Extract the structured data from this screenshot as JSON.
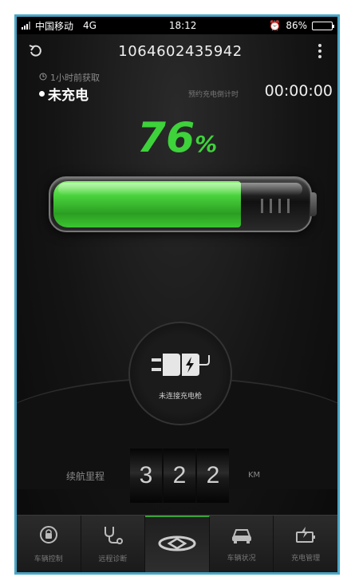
{
  "status_bar": {
    "carrier": "中国移动",
    "network": "4G",
    "time": "18:12",
    "battery": "86%",
    "battery_level": 0.86
  },
  "header": {
    "title": "1064602435942"
  },
  "info": {
    "fetched_text": "1小时前获取",
    "charge_state": "未充电",
    "countdown_label": "预约充电倒计时",
    "countdown_value": "00:00:00"
  },
  "battery": {
    "percent_number": "76",
    "percent_unit": "%",
    "level": 0.76,
    "fill_color": "#3ed23b"
  },
  "plug": {
    "label": "未连接充电枪"
  },
  "range": {
    "label": "续航里程",
    "digits": [
      "3",
      "2",
      "2"
    ],
    "unit": "KM"
  },
  "tabs": [
    {
      "label": "车辆控制",
      "icon": "vehicle-control-icon"
    },
    {
      "label": "远程诊断",
      "icon": "remote-diagnosis-icon"
    },
    {
      "label": "",
      "icon": "brand-logo-icon"
    },
    {
      "label": "车辆状况",
      "icon": "vehicle-status-icon"
    },
    {
      "label": "充电管理",
      "icon": "charging-management-icon"
    }
  ]
}
